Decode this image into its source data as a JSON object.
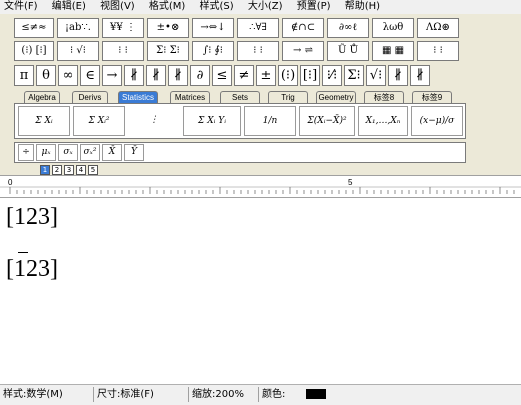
{
  "menu": [
    "文件(F)",
    "编辑(E)",
    "视图(V)",
    "格式(M)",
    "样式(S)",
    "大小(Z)",
    "预置(P)",
    "帮助(H)"
  ],
  "palette_row1": [
    "≤≠≈",
    "¡ab∵.",
    "¥¥ ⋮",
    "±•⊗",
    "→⇔↓",
    "∴∀∃",
    "∉∩⊂",
    "∂∞ℓ",
    "λωθ",
    "ΛΩ⊛"
  ],
  "palette_row2": [
    "(⁝) [⁝]",
    "⁝ √⁝",
    "⁝ ⁝",
    "Σ⁝ Σ⁝",
    "∫⁝ ∮⁝",
    "⁝ ⁝",
    "→ ⇌",
    "Ũ Ů",
    "▦ ▦",
    "⁝ ⁝"
  ],
  "palette_row3": [
    "π",
    "θ",
    "∞",
    "∈",
    "→",
    "∦",
    "∦",
    "∦",
    "∂",
    "≤",
    "≠",
    "±",
    "(⁝)",
    "[⁝]",
    "⁝⁄⁝",
    "Σ⁝",
    "√⁝",
    "∦",
    "∦"
  ],
  "tabs": [
    "Algebra",
    "Derivs",
    "Statistics",
    "Matrices",
    "Sets",
    "Trig",
    "Geometry",
    "标签8",
    "标签9"
  ],
  "templates_row1": [
    "Σ Xᵢ",
    "Σ Xᵢ²",
    "⋮",
    "Σ Xᵢ Yᵢ",
    "1/n",
    "Σ(Xᵢ−X̄)²",
    "X₁,…,Xₙ",
    "(x−μ)/σ"
  ],
  "templates_row2": [
    "÷",
    "μₓ",
    "σₓ",
    "σₓ²",
    "X̄",
    "Ȳ"
  ],
  "small_buttons": [
    "1",
    "2",
    "3",
    "4",
    "5"
  ],
  "ruler": {
    "marks": [
      "0",
      "5"
    ]
  },
  "editor": {
    "line1": "[123]",
    "line2": "[123]"
  },
  "status": {
    "style_label": "样式:",
    "style_value": "数学(M)",
    "size_label": "尺寸:",
    "size_value": "标准(F)",
    "zoom_label": "缩放:",
    "zoom_value": "200%",
    "color_label": "颜色:",
    "color": "#000000"
  }
}
